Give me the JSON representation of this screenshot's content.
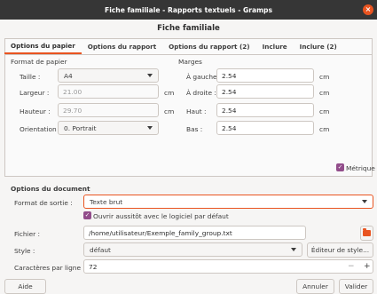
{
  "window": {
    "title": "Fiche familiale - Rapports textuels - Gramps",
    "close_glyph": "×"
  },
  "dialog": {
    "heading": "Fiche familiale"
  },
  "tabs": [
    {
      "label": "Options du papier"
    },
    {
      "label": "Options du rapport"
    },
    {
      "label": "Options du rapport (2)"
    },
    {
      "label": "Inclure"
    },
    {
      "label": "Inclure (2)"
    }
  ],
  "paper": {
    "format_label": "Format de papier",
    "margins_label": "Marges",
    "size_label": "Taille :",
    "size_value": "A4",
    "width_label": "Largeur :",
    "width_value": "21.00",
    "height_label": "Hauteur :",
    "height_value": "29.70",
    "orientation_label": "Orientation :",
    "orientation_value": "0. Portrait",
    "unit": "cm",
    "left_label": "À gauche :",
    "left_value": "2.54",
    "right_label": "À droite :",
    "right_value": "2.54",
    "top_label": "Haut :",
    "top_value": "2.54",
    "bottom_label": "Bas :",
    "bottom_value": "2.54",
    "metric_label": "Métrique",
    "metric_checked": true
  },
  "document": {
    "section_label": "Options du document",
    "output_format_label": "Format de sortie :",
    "output_format_value": "Texte brut",
    "open_default_label": "Ouvrir aussitôt avec le logiciel par défaut",
    "open_default_checked": true,
    "file_label": "Fichier :",
    "file_value": "/home/utilisateur/Exemple_family_group.txt",
    "style_label": "Style :",
    "style_value": "défaut",
    "style_editor_label": "Éditeur de style...",
    "chars_per_line_label": "Caractères par ligne :",
    "chars_per_line_value": "72",
    "minus": "−",
    "plus": "+"
  },
  "footer": {
    "help": "Aide",
    "cancel": "Annuler",
    "ok": "Valider"
  },
  "colors": {
    "accent": "#e95420",
    "check": "#924d8b",
    "titlebar": "#363636"
  }
}
